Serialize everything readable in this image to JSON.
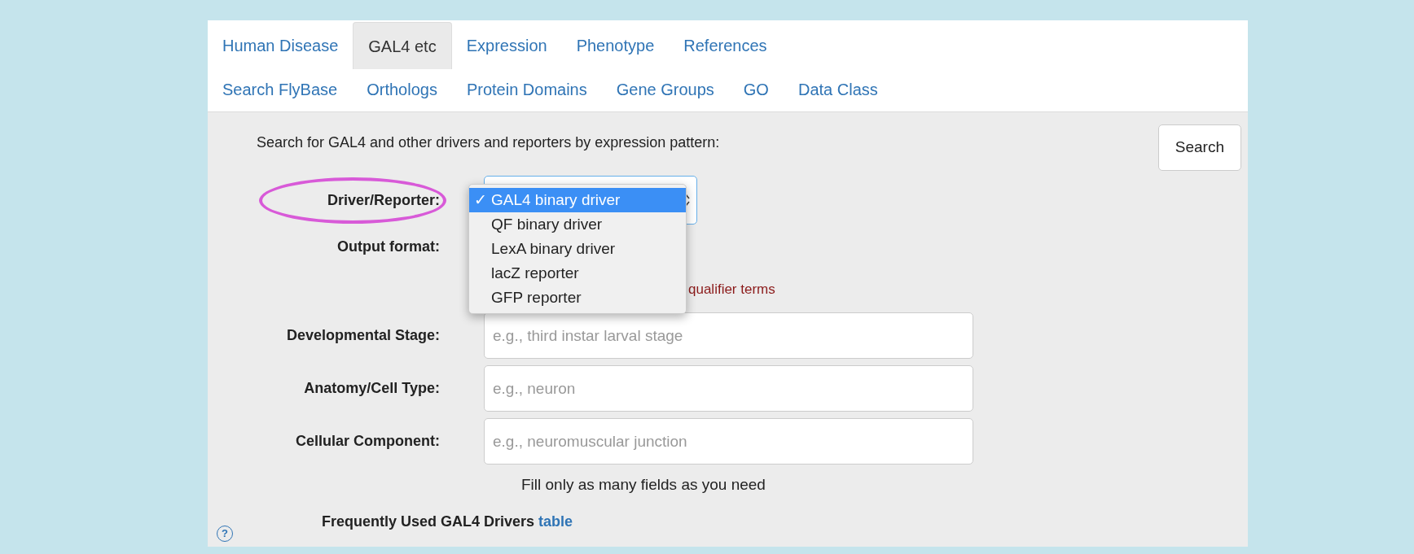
{
  "tabs_row_1": [
    {
      "label": "Human Disease",
      "selected": false
    },
    {
      "label": "GAL4 etc",
      "selected": true
    },
    {
      "label": "Expression",
      "selected": false
    },
    {
      "label": "Phenotype",
      "selected": false
    },
    {
      "label": "References",
      "selected": false
    }
  ],
  "tabs_row_2": [
    {
      "label": "Search FlyBase",
      "selected": false
    },
    {
      "label": "Orthologs",
      "selected": false
    },
    {
      "label": "Protein Domains",
      "selected": false
    },
    {
      "label": "Gene Groups",
      "selected": false
    },
    {
      "label": "GO",
      "selected": false
    },
    {
      "label": "Data Class",
      "selected": false
    }
  ],
  "intro": "Search for GAL4 and other drivers and reporters by expression pattern:",
  "search_button": "Search",
  "driver_label": "Driver/Reporter:",
  "output_label": "Output format:",
  "qualifier_note": "qualifier terms",
  "dropdown": {
    "check_mark": "✓",
    "options": [
      {
        "label": "GAL4 binary driver",
        "selected": true
      },
      {
        "label": "QF binary driver",
        "selected": false
      },
      {
        "label": "LexA binary driver",
        "selected": false
      },
      {
        "label": "lacZ reporter",
        "selected": false
      },
      {
        "label": "GFP reporter",
        "selected": false
      }
    ]
  },
  "fields": [
    {
      "label": "Developmental Stage:",
      "placeholder": "e.g., third instar larval stage"
    },
    {
      "label": "Anatomy/Cell Type:",
      "placeholder": "e.g., neuron"
    },
    {
      "label": "Cellular Component:",
      "placeholder": "e.g., neuromuscular junction"
    }
  ],
  "hint": "Fill only as many fields as you need",
  "frequently_used": {
    "text": "Frequently Used GAL4 Drivers",
    "link": "table"
  },
  "help_icon": "?"
}
